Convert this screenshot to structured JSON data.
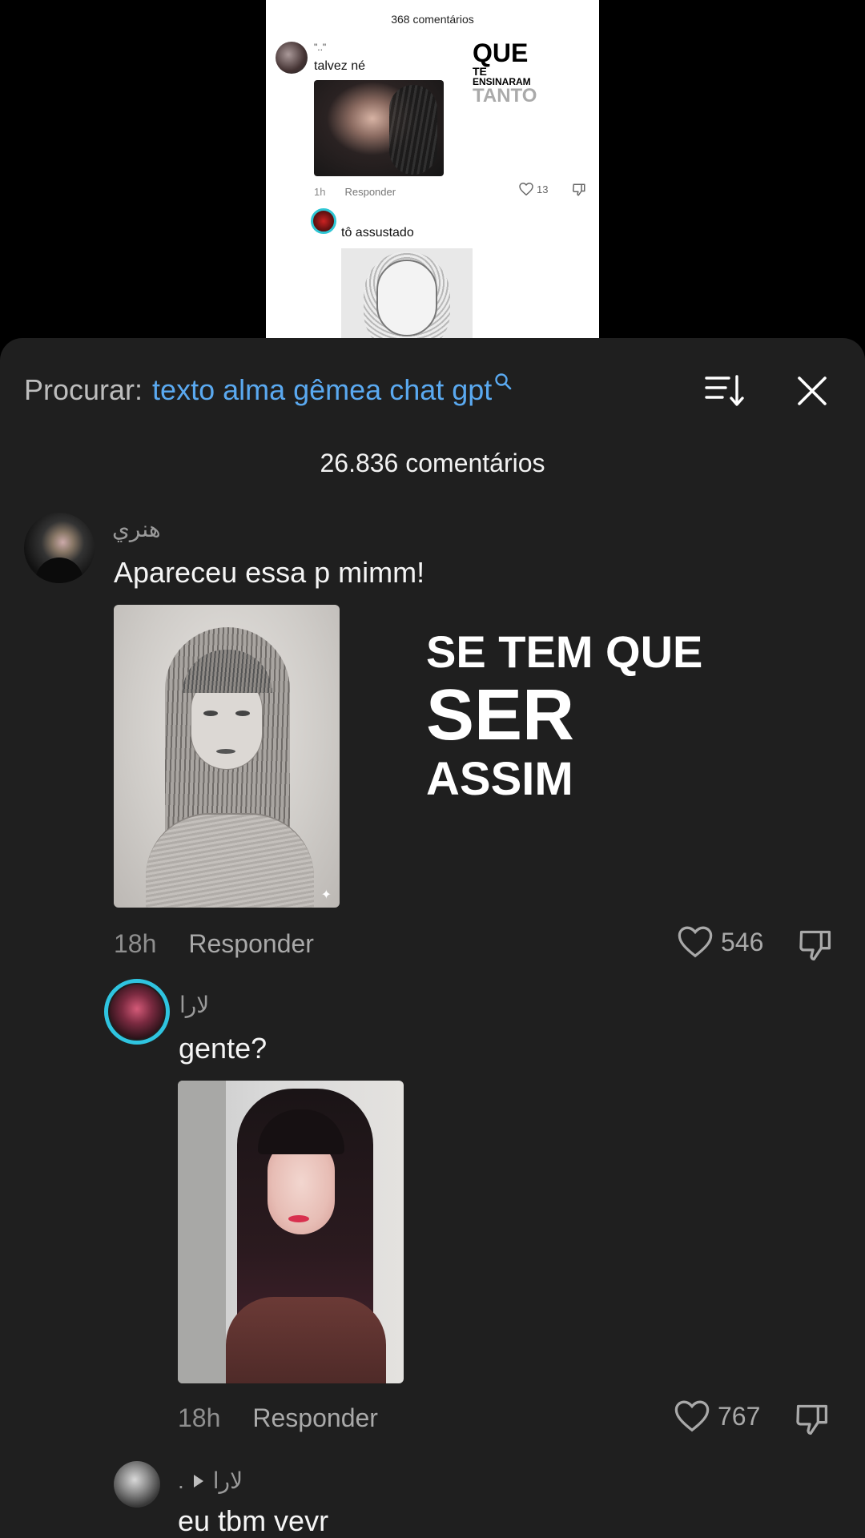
{
  "video": {
    "comment_count": "368 comentários",
    "comment1": {
      "username": "\"..\"",
      "text": "talvez né",
      "time": "1h",
      "reply": "Responder",
      "likes": "13"
    },
    "overlay": {
      "l1": "QUE",
      "l2": "TE",
      "l3": "ENSINARAM",
      "l4": "TANTO"
    },
    "comment2": {
      "text": "tô assustado"
    }
  },
  "search": {
    "prefix": "Procurar:",
    "query": "texto alma gêmea chat gpt"
  },
  "sheet": {
    "title": "26.836 comentários"
  },
  "overlay_text": {
    "line1": "SE TEM QUE",
    "line2": "SER",
    "line3": "ASSIM"
  },
  "comments": [
    {
      "username": "هنري",
      "text": "Apareceu essa p mimm!",
      "time": "18h",
      "reply": "Responder",
      "likes": "546"
    },
    {
      "username": "لارا",
      "text": "gente?",
      "time": "18h",
      "reply": "Responder",
      "likes": "767"
    },
    {
      "username": ".",
      "reply_to": "لارا",
      "text": "eu tbm vevr"
    }
  ],
  "colors": {
    "sheet_bg": "#1f1f1f",
    "accent_link": "#5aa9f0",
    "story_ring": "#2fc4e0"
  },
  "icons": [
    "search-icon",
    "sort-icon",
    "close-icon",
    "heart-icon",
    "dislike-icon",
    "play-arrow-icon",
    "sparkle-icon"
  ]
}
